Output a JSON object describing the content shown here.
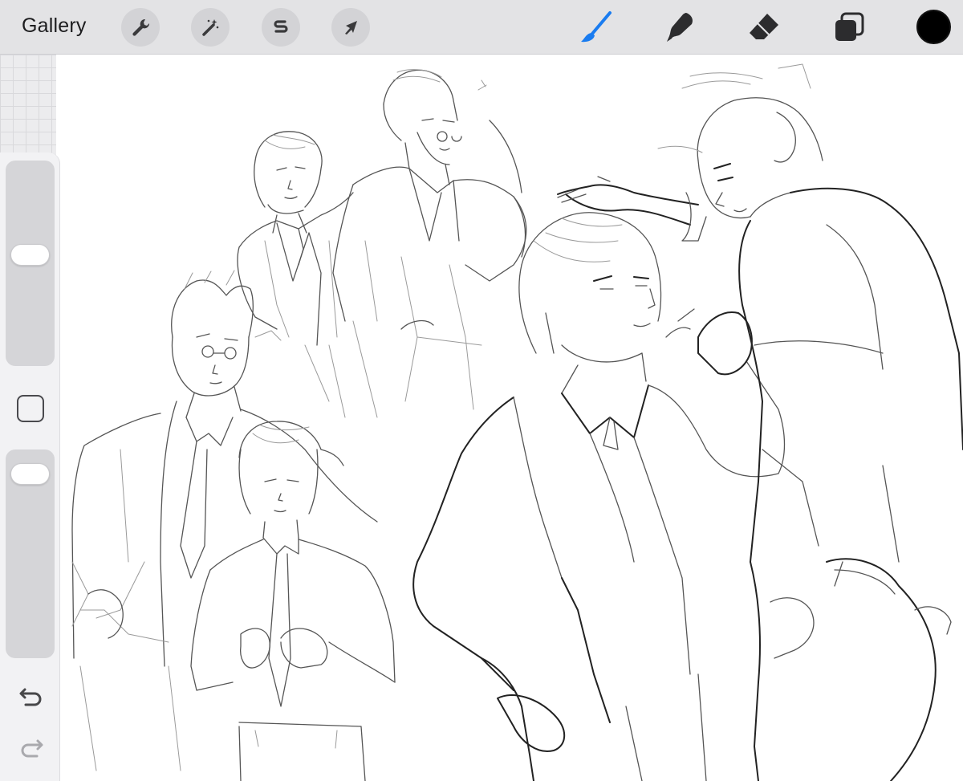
{
  "toolbar": {
    "gallery_label": "Gallery",
    "left_tools": [
      {
        "name": "actions",
        "icon": "wrench-icon"
      },
      {
        "name": "adjustments",
        "icon": "magic-wand-icon"
      },
      {
        "name": "selection",
        "icon": "selection-s-icon"
      },
      {
        "name": "transform",
        "icon": "arrow-cursor-icon"
      }
    ],
    "right_tools": [
      {
        "name": "brush",
        "icon": "brush-icon",
        "active": true
      },
      {
        "name": "smudge",
        "icon": "smudge-icon",
        "active": false
      },
      {
        "name": "eraser",
        "icon": "eraser-icon",
        "active": false
      },
      {
        "name": "layers",
        "icon": "layers-icon",
        "active": false
      }
    ],
    "current_color": "#000000",
    "active_tool_color": "#1a7cf0"
  },
  "sidebar": {
    "brush_size_level": 0.55,
    "opacity_level": 0.95,
    "modify_button_icon": "square-icon",
    "undo_icon": "undo-arrow-icon",
    "redo_icon": "redo-arrow-icon"
  },
  "canvas": {
    "background": "#ffffff",
    "content": "pencil-sketch-artwork"
  }
}
